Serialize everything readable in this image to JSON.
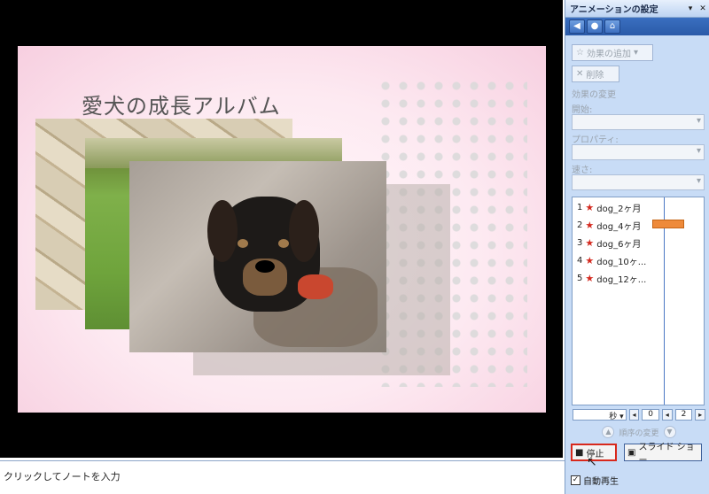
{
  "slide": {
    "title": "愛犬の成長アルバム"
  },
  "notes": {
    "placeholder": "クリックしてノートを入力"
  },
  "pane": {
    "title": "アニメーションの設定",
    "nav": [
      "◀",
      "●",
      "⌂"
    ],
    "add_effect": "効果の追加",
    "remove": "削除",
    "change_effect": "効果の変更",
    "start_label": "開始:",
    "property_label": "プロパティ:",
    "speed_label": "速さ:",
    "items": [
      {
        "num": "1",
        "name": "dog_2ヶ月"
      },
      {
        "num": "2",
        "name": "dog_4ヶ月"
      },
      {
        "num": "3",
        "name": "dog_6ヶ月"
      },
      {
        "num": "4",
        "name": "dog_10ヶ..."
      },
      {
        "num": "5",
        "name": "dog_12ヶ..."
      }
    ],
    "timeline": {
      "unit": "秒",
      "from": "0",
      "to": "2"
    },
    "reorder_label": "順序の変更",
    "stop_label": "停止",
    "slideshow_label": "スライド ショー",
    "autoplay_label": "自動再生"
  }
}
